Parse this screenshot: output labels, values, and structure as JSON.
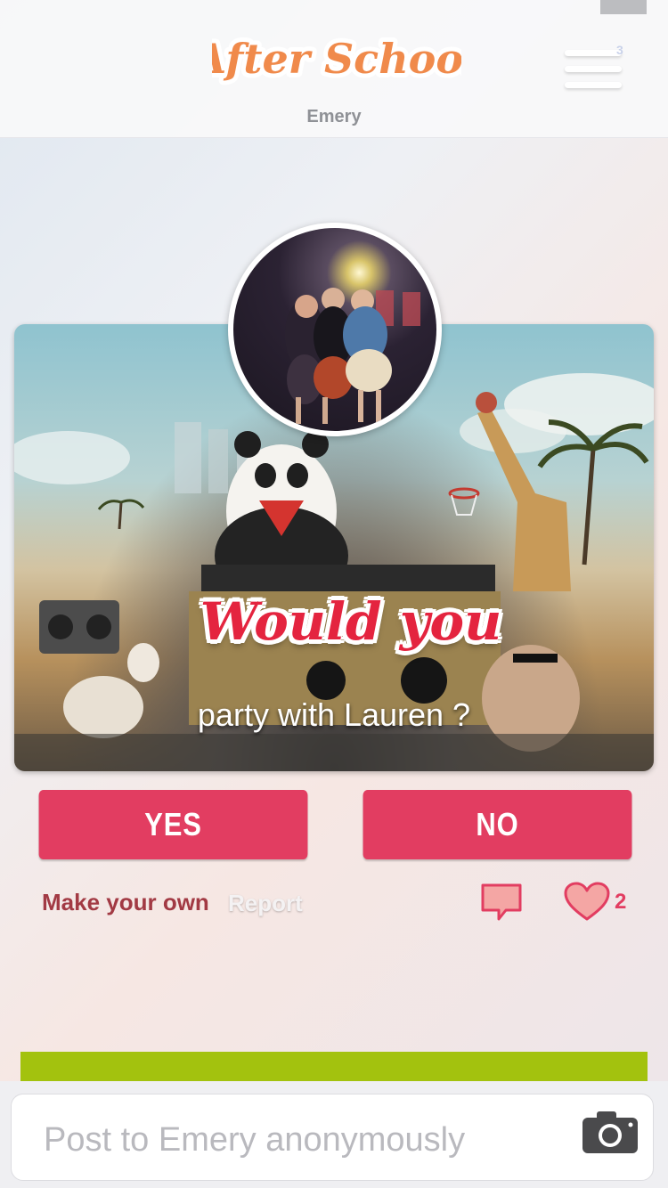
{
  "header": {
    "logo_text": "After School",
    "school_name": "Emery",
    "menu_badge": "3"
  },
  "post": {
    "headline": "Would you",
    "question": "party with Lauren ?"
  },
  "actions": {
    "yes_label": "YES",
    "no_label": "NO",
    "make_own_label": "Make your own",
    "report_label": "Report",
    "like_count": "2"
  },
  "composer": {
    "placeholder": "Post to Emery anonymously"
  },
  "colors": {
    "accent": "#e23d61",
    "make_own": "#a23a44",
    "green_bar": "#a3c20e"
  },
  "icons": [
    "hamburger-menu-icon",
    "comment-icon",
    "heart-icon",
    "camera-icon"
  ]
}
